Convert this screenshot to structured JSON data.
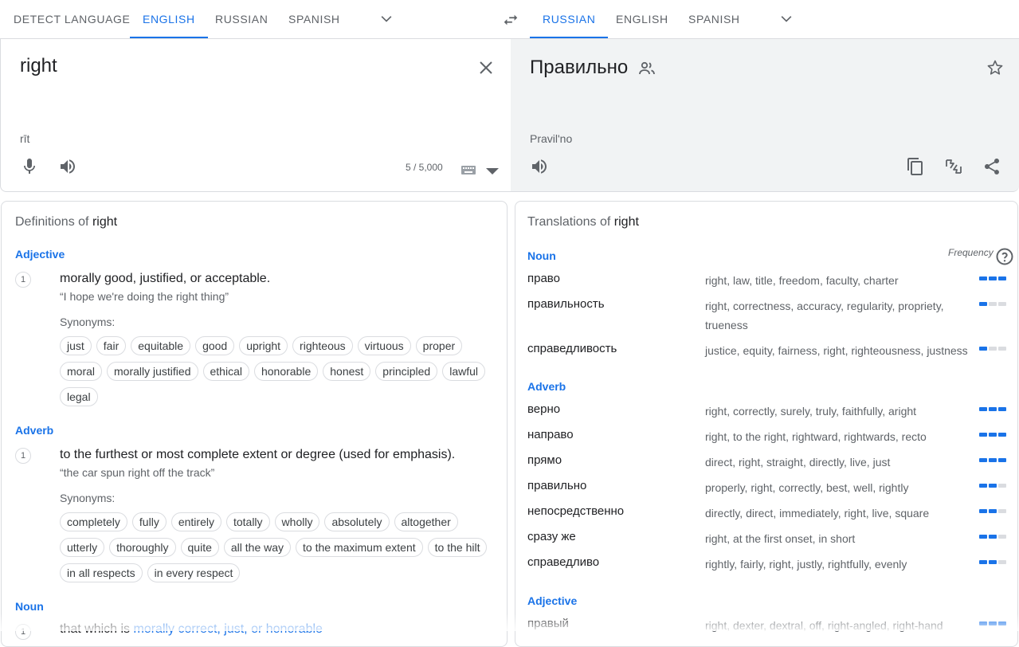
{
  "source_langs": {
    "tabs": [
      {
        "label": "DETECT LANGUAGE",
        "active": false
      },
      {
        "label": "ENGLISH",
        "active": true
      },
      {
        "label": "RUSSIAN",
        "active": false
      },
      {
        "label": "SPANISH",
        "active": false
      }
    ]
  },
  "target_langs": {
    "tabs": [
      {
        "label": "RUSSIAN",
        "active": true
      },
      {
        "label": "ENGLISH",
        "active": false
      },
      {
        "label": "SPANISH",
        "active": false
      }
    ]
  },
  "source": {
    "text": "right",
    "transliteration": "rīt",
    "char_count": "5 / 5,000"
  },
  "target": {
    "text": "Правильно",
    "transliteration": "Pravil'no"
  },
  "definitions": {
    "title_prefix": "Definitions of ",
    "title_word": "right",
    "sections": [
      {
        "pos": "Adjective",
        "num": "1",
        "gloss": "morally good, justified, or acceptable.",
        "example": "“I hope we're doing the right thing”",
        "syn_label": "Synonyms:",
        "synonyms": [
          "just",
          "fair",
          "equitable",
          "good",
          "upright",
          "righteous",
          "virtuous",
          "proper",
          "moral",
          "morally justified",
          "ethical",
          "honorable",
          "honest",
          "principled",
          "lawful",
          "legal"
        ]
      },
      {
        "pos": "Adverb",
        "num": "1",
        "gloss": "to the furthest or most complete extent or degree (used for emphasis).",
        "example": "“the car spun right off the track”",
        "syn_label": "Synonyms:",
        "synonyms": [
          "completely",
          "fully",
          "entirely",
          "totally",
          "wholly",
          "absolutely",
          "altogether",
          "utterly",
          "thoroughly",
          "quite",
          "all the way",
          "to the maximum extent",
          "to the hilt",
          "in all respects",
          "in every respect"
        ]
      }
    ],
    "third_pos": "Noun",
    "third_num": "1",
    "partial_gloss_a": "that which is ",
    "partial_gloss_b": "morally correct, just, or honorable"
  },
  "translations": {
    "title_prefix": "Translations of ",
    "title_word": "right",
    "frequency_label": "Frequency",
    "groups": [
      {
        "pos": "Noun",
        "rows": [
          {
            "word": "право",
            "syns": "right, law, title, freedom, faculty, charter",
            "freq": 3
          },
          {
            "word": "правильность",
            "syns": "right, correctness, accuracy, regularity, propriety, trueness",
            "freq": 1
          },
          {
            "word": "справедливость",
            "syns": "justice, equity, fairness, right, righteousness, justness",
            "freq": 1
          }
        ]
      },
      {
        "pos": "Adverb",
        "rows": [
          {
            "word": "верно",
            "syns": "right, correctly, surely, truly, faithfully, aright",
            "freq": 3
          },
          {
            "word": "направо",
            "syns": "right, to the right, rightward, rightwards, recto",
            "freq": 3
          },
          {
            "word": "прямо",
            "syns": "direct, right, straight, directly, live, just",
            "freq": 3
          },
          {
            "word": "правильно",
            "syns": "properly, right, correctly, best, well, rightly",
            "freq": 2
          },
          {
            "word": "непосредственно",
            "syns": "directly, direct, immediately, right, live, square",
            "freq": 2
          },
          {
            "word": "сразу же",
            "syns": "right, at the first onset, in short",
            "freq": 2
          },
          {
            "word": "справедливо",
            "syns": "rightly, fairly, right, justly, rightfully, evenly",
            "freq": 2
          }
        ]
      },
      {
        "pos": "Adjective",
        "rows": [
          {
            "word": "правый",
            "syns": "right, dexter, dextral, off, right-angled, right-hand",
            "freq": 3
          }
        ]
      }
    ]
  },
  "icons": {
    "clear": "close-icon",
    "mic": "microphone-icon",
    "speaker": "speaker-icon",
    "keyboard": "keyboard-icon",
    "swap": "swap-icon",
    "star": "star-icon",
    "copy": "copy-icon",
    "feedback": "feedback-icon",
    "share": "share-icon",
    "community": "community-icon"
  },
  "colors": {
    "accent": "#1a73e8",
    "target_bg": "#f1f3f4"
  }
}
